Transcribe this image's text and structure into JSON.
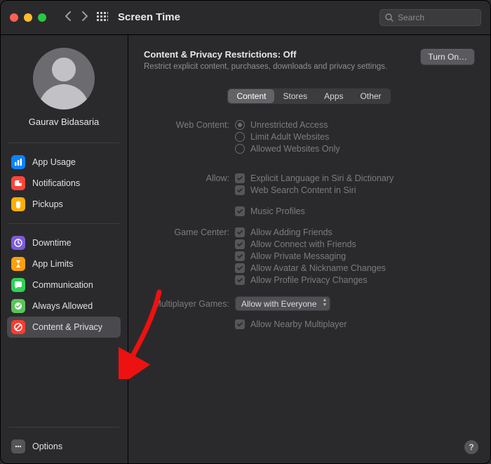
{
  "window": {
    "title": "Screen Time",
    "search_placeholder": "Search"
  },
  "user": {
    "name": "Gaurav Bidasaria"
  },
  "sidebar": {
    "group1": [
      {
        "label": "App Usage"
      },
      {
        "label": "Notifications"
      },
      {
        "label": "Pickups"
      }
    ],
    "group2": [
      {
        "label": "Downtime"
      },
      {
        "label": "App Limits"
      },
      {
        "label": "Communication"
      },
      {
        "label": "Always Allowed"
      },
      {
        "label": "Content & Privacy"
      }
    ],
    "options_label": "Options"
  },
  "header": {
    "title_prefix": "Content & Privacy Restrictions: ",
    "state": "Off",
    "subtitle": "Restrict explicit content, purchases, downloads and privacy settings.",
    "turn_on": "Turn On…"
  },
  "tabs": [
    "Content",
    "Stores",
    "Apps",
    "Other"
  ],
  "sections": {
    "web_content": {
      "label": "Web Content:",
      "options": [
        "Unrestricted Access",
        "Limit Adult Websites",
        "Allowed Websites Only"
      ]
    },
    "allow": {
      "label": "Allow:",
      "options": [
        "Explicit Language in Siri & Dictionary",
        "Web Search Content in Siri",
        "Music Profiles"
      ]
    },
    "game_center": {
      "label": "Game Center:",
      "options": [
        "Allow Adding Friends",
        "Allow Connect with Friends",
        "Allow Private Messaging",
        "Allow Avatar & Nickname Changes",
        "Allow Profile Privacy Changes"
      ]
    },
    "multiplayer": {
      "label": "Multiplayer Games:",
      "select": "Allow with Everyone",
      "nearby": "Allow Nearby Multiplayer"
    }
  },
  "help": "?"
}
